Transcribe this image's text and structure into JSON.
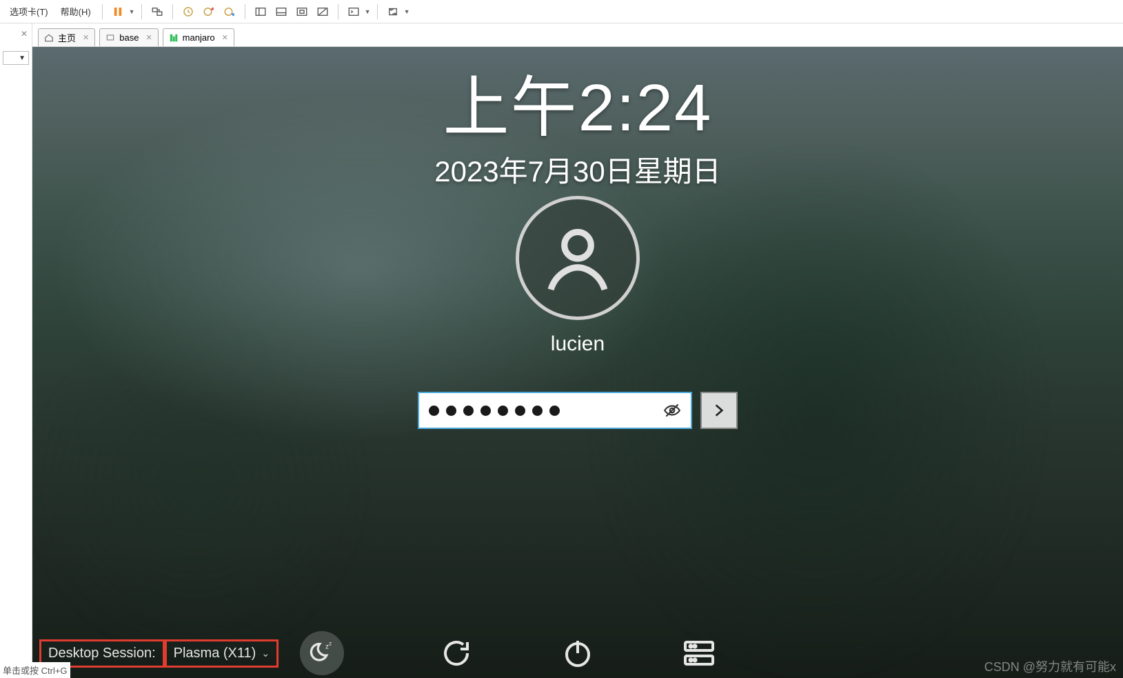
{
  "menus": {
    "tabs": "选项卡(T)",
    "help": "帮助(H)"
  },
  "tabs": {
    "home": "主页",
    "base": "base",
    "manjaro": "manjaro"
  },
  "login": {
    "time": "上午2:24",
    "date": "2023年7月30日星期日",
    "username": "lucien",
    "password_dots": 8
  },
  "session": {
    "label": "Desktop Session:",
    "value": "Plasma (X11)"
  },
  "watermark": "CSDN @努力就有可能x",
  "status": "单击或按 Ctrl+G"
}
